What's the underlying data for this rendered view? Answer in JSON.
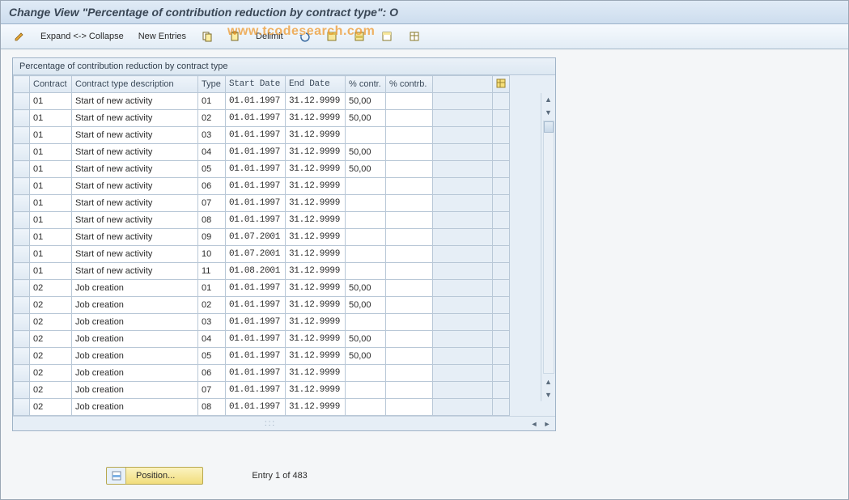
{
  "title": "Change View \"Percentage of contribution reduction by contract type\": O",
  "toolbar": {
    "expand_collapse": "Expand <-> Collapse",
    "new_entries": "New Entries",
    "delimit": "Delimit",
    "icons": {
      "pencil": "✎",
      "copy": "⎘",
      "clipboard": "📋",
      "undo": "⟲",
      "select_all": "▦",
      "select_block": "▥",
      "deselect": "▤",
      "table_settings": "▦"
    }
  },
  "watermark": "www.tcodesearch.com",
  "panel": {
    "title": "Percentage of contribution reduction by contract type"
  },
  "columns": {
    "contract": "Contract",
    "desc": "Contract type description",
    "type": "Type",
    "start": "Start Date",
    "end": "End Date",
    "pct1": "% contr.",
    "pct2": "% contrb."
  },
  "rows": [
    {
      "contract": "01",
      "desc": "Start of new activity",
      "type": "01",
      "start": "01.01.1997",
      "end": "31.12.9999",
      "pct1": "50,00",
      "pct2": ""
    },
    {
      "contract": "01",
      "desc": "Start of new activity",
      "type": "02",
      "start": "01.01.1997",
      "end": "31.12.9999",
      "pct1": "50,00",
      "pct2": ""
    },
    {
      "contract": "01",
      "desc": "Start of new activity",
      "type": "03",
      "start": "01.01.1997",
      "end": "31.12.9999",
      "pct1": "",
      "pct2": ""
    },
    {
      "contract": "01",
      "desc": "Start of new activity",
      "type": "04",
      "start": "01.01.1997",
      "end": "31.12.9999",
      "pct1": "50,00",
      "pct2": ""
    },
    {
      "contract": "01",
      "desc": "Start of new activity",
      "type": "05",
      "start": "01.01.1997",
      "end": "31.12.9999",
      "pct1": "50,00",
      "pct2": ""
    },
    {
      "contract": "01",
      "desc": "Start of new activity",
      "type": "06",
      "start": "01.01.1997",
      "end": "31.12.9999",
      "pct1": "",
      "pct2": ""
    },
    {
      "contract": "01",
      "desc": "Start of new activity",
      "type": "07",
      "start": "01.01.1997",
      "end": "31.12.9999",
      "pct1": "",
      "pct2": ""
    },
    {
      "contract": "01",
      "desc": "Start of new activity",
      "type": "08",
      "start": "01.01.1997",
      "end": "31.12.9999",
      "pct1": "",
      "pct2": ""
    },
    {
      "contract": "01",
      "desc": "Start of new activity",
      "type": "09",
      "start": "01.07.2001",
      "end": "31.12.9999",
      "pct1": "",
      "pct2": ""
    },
    {
      "contract": "01",
      "desc": "Start of new activity",
      "type": "10",
      "start": "01.07.2001",
      "end": "31.12.9999",
      "pct1": "",
      "pct2": ""
    },
    {
      "contract": "01",
      "desc": "Start of new activity",
      "type": "11",
      "start": "01.08.2001",
      "end": "31.12.9999",
      "pct1": "",
      "pct2": ""
    },
    {
      "contract": "02",
      "desc": "Job creation",
      "type": "01",
      "start": "01.01.1997",
      "end": "31.12.9999",
      "pct1": "50,00",
      "pct2": ""
    },
    {
      "contract": "02",
      "desc": "Job creation",
      "type": "02",
      "start": "01.01.1997",
      "end": "31.12.9999",
      "pct1": "50,00",
      "pct2": ""
    },
    {
      "contract": "02",
      "desc": "Job creation",
      "type": "03",
      "start": "01.01.1997",
      "end": "31.12.9999",
      "pct1": "",
      "pct2": ""
    },
    {
      "contract": "02",
      "desc": "Job creation",
      "type": "04",
      "start": "01.01.1997",
      "end": "31.12.9999",
      "pct1": "50,00",
      "pct2": ""
    },
    {
      "contract": "02",
      "desc": "Job creation",
      "type": "05",
      "start": "01.01.1997",
      "end": "31.12.9999",
      "pct1": "50,00",
      "pct2": ""
    },
    {
      "contract": "02",
      "desc": "Job creation",
      "type": "06",
      "start": "01.01.1997",
      "end": "31.12.9999",
      "pct1": "",
      "pct2": ""
    },
    {
      "contract": "02",
      "desc": "Job creation",
      "type": "07",
      "start": "01.01.1997",
      "end": "31.12.9999",
      "pct1": "",
      "pct2": ""
    },
    {
      "contract": "02",
      "desc": "Job creation",
      "type": "08",
      "start": "01.01.1997",
      "end": "31.12.9999",
      "pct1": "",
      "pct2": ""
    }
  ],
  "footer": {
    "position_label": "Position...",
    "entry_text": "Entry 1 of 483"
  }
}
